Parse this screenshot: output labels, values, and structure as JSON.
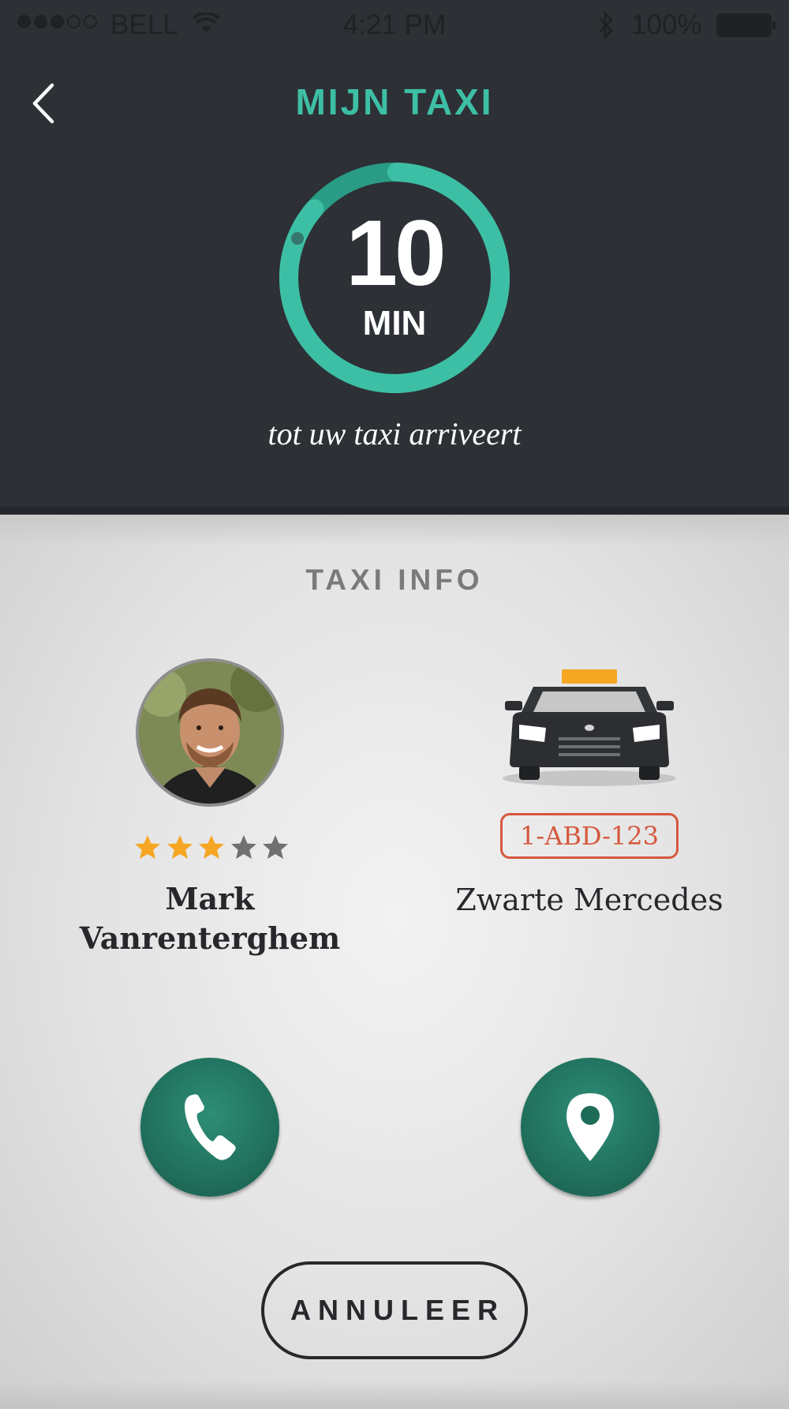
{
  "status_bar": {
    "carrier": "BELL",
    "time": "4:21 PM",
    "battery": "100%"
  },
  "header": {
    "title": "MIJN TAXI"
  },
  "timer": {
    "value": "10",
    "unit": "MIN",
    "progress": 0.86,
    "subtitle": "tot uw taxi arriveert"
  },
  "taxi_info": {
    "title": "TAXI INFO",
    "driver": {
      "name": "Mark Vanrenterghem",
      "rating": 3,
      "max_rating": 5
    },
    "vehicle": {
      "plate": "1-ABD-123",
      "model": "Zwarte Mercedes"
    }
  },
  "actions": {
    "call_icon": "phone-icon",
    "location_icon": "location-pin-icon",
    "cancel_label": "ANNULEER"
  },
  "colors": {
    "accent": "#3dbfa5",
    "header_bg": "#2d3035",
    "action_green": "#1e6b58",
    "plate_red": "#d5583d",
    "star_filled": "#f5a623",
    "star_empty": "#707070"
  }
}
